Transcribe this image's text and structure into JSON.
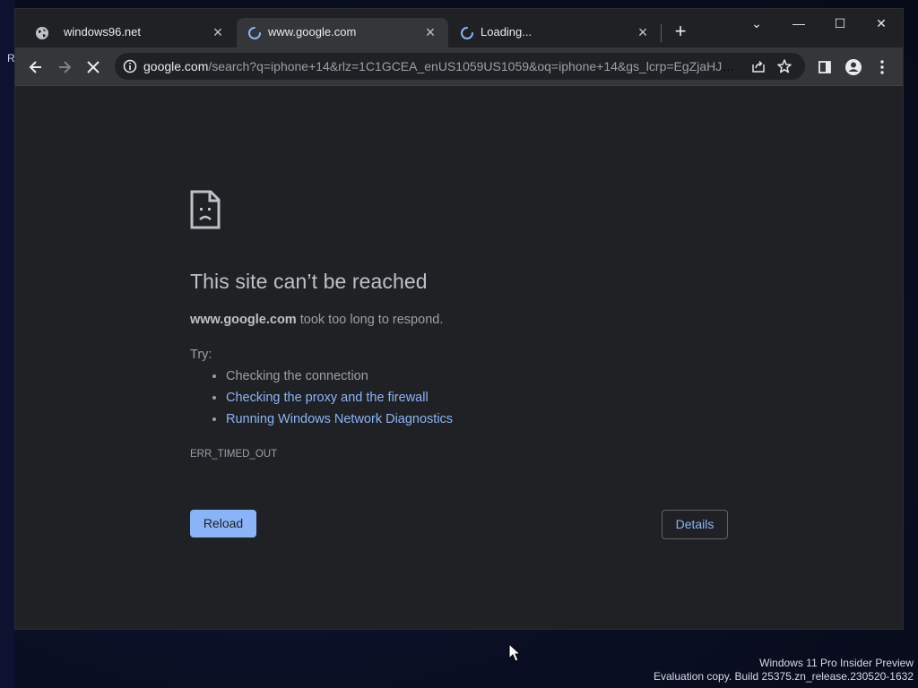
{
  "desktop": {
    "left_text": "R",
    "watermark_line1": "Windows 11 Pro Insider Preview",
    "watermark_line2": "Evaluation copy. Build 25375.zn_release.230520-1632"
  },
  "tabs": [
    {
      "title": "windows96.net",
      "icon": "globe-icon",
      "active": false
    },
    {
      "title": "www.google.com",
      "icon": "loading-spinner-icon",
      "active": true
    },
    {
      "title": "Loading...",
      "icon": "loading-spinner-icon",
      "active": false
    }
  ],
  "window_controls": {
    "tab_search": "⌄",
    "minimize": "—",
    "maximize": "☐",
    "close": "✕"
  },
  "omnibox": {
    "host": "google.com",
    "path": "/search?q=iphone+14&rlz=1C1GCEA_enUS1059US1059&oq=iphone+14&gs_lcrp=EgZjaHJvb..."
  },
  "error": {
    "title": "This site can’t be reached",
    "host": "www.google.com",
    "message": " took too long to respond.",
    "try_label": "Try:",
    "suggestions": [
      "Checking the connection",
      "Checking the proxy and the firewall",
      "Running Windows Network Diagnostics"
    ],
    "code": "ERR_TIMED_OUT",
    "reload_label": "Reload",
    "details_label": "Details"
  },
  "colors": {
    "page_bg": "#202124",
    "toolbar_bg": "#35363a",
    "link": "#8ab4f8",
    "title_text": "#bdc1c6",
    "body_text": "#9aa0a6"
  }
}
